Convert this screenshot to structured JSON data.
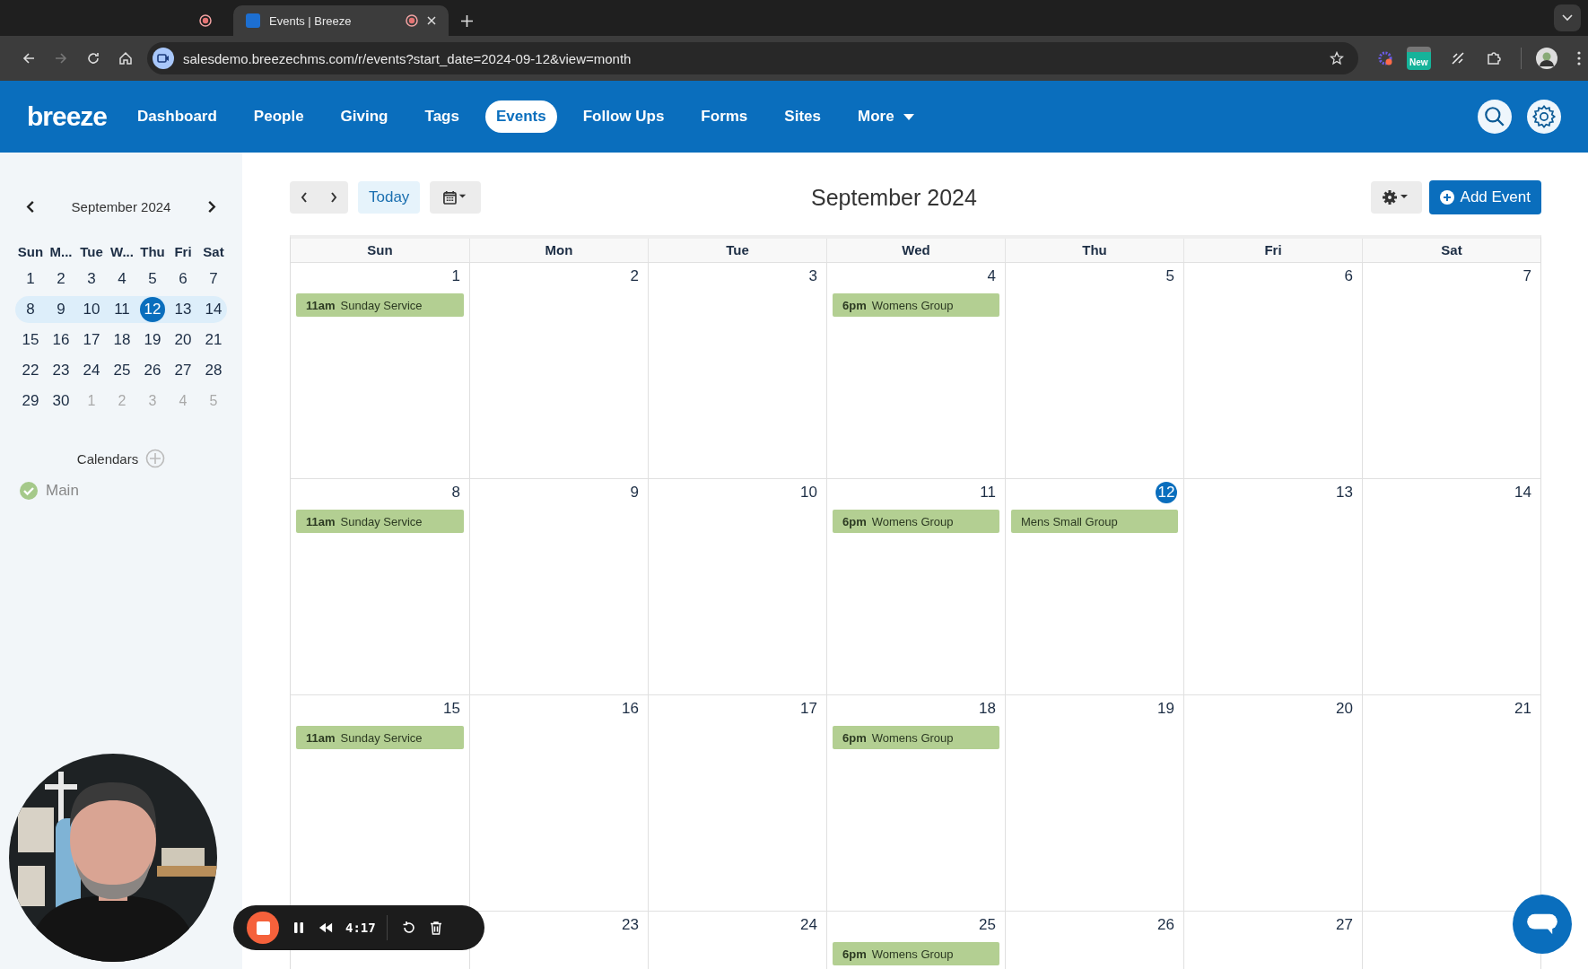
{
  "browser": {
    "tabs": [
      {
        "recording": true,
        "selected": false
      },
      {
        "title": "Events | Breeze",
        "recording": true,
        "selected": true
      }
    ],
    "url": "salesdemo.breezechms.com/r/events?start_date=2024-09-12&view=month",
    "extension_badge": "New"
  },
  "nav": {
    "logo": "breeze",
    "items": [
      {
        "label": "Dashboard",
        "selected": false
      },
      {
        "label": "People",
        "selected": false
      },
      {
        "label": "Giving",
        "selected": false
      },
      {
        "label": "Tags",
        "selected": false
      },
      {
        "label": "Events",
        "selected": true
      },
      {
        "label": "Follow Ups",
        "selected": false
      },
      {
        "label": "Forms",
        "selected": false
      },
      {
        "label": "Sites",
        "selected": false
      },
      {
        "label": "More",
        "selected": false,
        "dropdown": true
      }
    ]
  },
  "sidebar": {
    "month": "September 2024",
    "weekdays": [
      "Sun",
      "M...",
      "Tue",
      "W...",
      "Thu",
      "Fri",
      "Sat"
    ],
    "weeks": [
      {
        "current": false,
        "days": [
          {
            "label": "1",
            "muted": false,
            "selected": false
          },
          {
            "label": "2",
            "muted": false,
            "selected": false
          },
          {
            "label": "3",
            "muted": false,
            "selected": false
          },
          {
            "label": "4",
            "muted": false,
            "selected": false
          },
          {
            "label": "5",
            "muted": false,
            "selected": false
          },
          {
            "label": "6",
            "muted": false,
            "selected": false
          },
          {
            "label": "7",
            "muted": false,
            "selected": false
          }
        ]
      },
      {
        "current": true,
        "days": [
          {
            "label": "8",
            "muted": false,
            "selected": false
          },
          {
            "label": "9",
            "muted": false,
            "selected": false
          },
          {
            "label": "10",
            "muted": false,
            "selected": false
          },
          {
            "label": "11",
            "muted": false,
            "selected": false
          },
          {
            "label": "12",
            "muted": false,
            "selected": true
          },
          {
            "label": "13",
            "muted": false,
            "selected": false
          },
          {
            "label": "14",
            "muted": false,
            "selected": false
          }
        ]
      },
      {
        "current": false,
        "days": [
          {
            "label": "15",
            "muted": false,
            "selected": false
          },
          {
            "label": "16",
            "muted": false,
            "selected": false
          },
          {
            "label": "17",
            "muted": false,
            "selected": false
          },
          {
            "label": "18",
            "muted": false,
            "selected": false
          },
          {
            "label": "19",
            "muted": false,
            "selected": false
          },
          {
            "label": "20",
            "muted": false,
            "selected": false
          },
          {
            "label": "21",
            "muted": false,
            "selected": false
          }
        ]
      },
      {
        "current": false,
        "days": [
          {
            "label": "22",
            "muted": false,
            "selected": false
          },
          {
            "label": "23",
            "muted": false,
            "selected": false
          },
          {
            "label": "24",
            "muted": false,
            "selected": false
          },
          {
            "label": "25",
            "muted": false,
            "selected": false
          },
          {
            "label": "26",
            "muted": false,
            "selected": false
          },
          {
            "label": "27",
            "muted": false,
            "selected": false
          },
          {
            "label": "28",
            "muted": false,
            "selected": false
          }
        ]
      },
      {
        "current": false,
        "days": [
          {
            "label": "29",
            "muted": false,
            "selected": false
          },
          {
            "label": "30",
            "muted": false,
            "selected": false
          },
          {
            "label": "1",
            "muted": true,
            "selected": false
          },
          {
            "label": "2",
            "muted": true,
            "selected": false
          },
          {
            "label": "3",
            "muted": true,
            "selected": false
          },
          {
            "label": "4",
            "muted": true,
            "selected": false
          },
          {
            "label": "5",
            "muted": true,
            "selected": false
          }
        ]
      }
    ],
    "calendars_heading": "Calendars",
    "calendars": [
      {
        "name": "Main",
        "checked": true
      }
    ]
  },
  "main": {
    "today_button": "Today",
    "title": "September 2024",
    "add_button": "Add Event",
    "columns": [
      "Sun",
      "Mon",
      "Tue",
      "Wed",
      "Thu",
      "Fri",
      "Sat"
    ],
    "weeks": [
      [
        {
          "date": "1",
          "today": false,
          "events": [
            {
              "time": "11am",
              "title": "Sunday Service"
            }
          ]
        },
        {
          "date": "2",
          "today": false
        },
        {
          "date": "3",
          "today": false
        },
        {
          "date": "4",
          "today": false,
          "events": [
            {
              "time": "6pm",
              "title": "Womens Group"
            }
          ]
        },
        {
          "date": "5",
          "today": false
        },
        {
          "date": "6",
          "today": false
        },
        {
          "date": "7",
          "today": false
        }
      ],
      [
        {
          "date": "8",
          "today": false,
          "events": [
            {
              "time": "11am",
              "title": "Sunday Service"
            }
          ]
        },
        {
          "date": "9",
          "today": false
        },
        {
          "date": "10",
          "today": false
        },
        {
          "date": "11",
          "today": false,
          "events": [
            {
              "time": "6pm",
              "title": "Womens Group"
            }
          ]
        },
        {
          "date": "12",
          "today": true,
          "events": [
            {
              "title": "Mens Small Group"
            }
          ]
        },
        {
          "date": "13",
          "today": false
        },
        {
          "date": "14",
          "today": false
        }
      ],
      [
        {
          "date": "15",
          "today": false,
          "events": [
            {
              "time": "11am",
              "title": "Sunday Service"
            }
          ]
        },
        {
          "date": "16",
          "today": false
        },
        {
          "date": "17",
          "today": false
        },
        {
          "date": "18",
          "today": false,
          "events": [
            {
              "time": "6pm",
              "title": "Womens Group"
            }
          ]
        },
        {
          "date": "19",
          "today": false
        },
        {
          "date": "20",
          "today": false
        },
        {
          "date": "21",
          "today": false
        }
      ],
      [
        {
          "today": false
        },
        {
          "date": "23",
          "today": false
        },
        {
          "date": "24",
          "today": false
        },
        {
          "date": "25",
          "today": false,
          "events": [
            {
              "time": "6pm",
              "title": "Womens Group"
            }
          ]
        },
        {
          "date": "26",
          "today": false
        },
        {
          "date": "27",
          "today": false
        },
        {
          "today": false
        }
      ]
    ]
  },
  "recorder": {
    "time": "4:17"
  }
}
